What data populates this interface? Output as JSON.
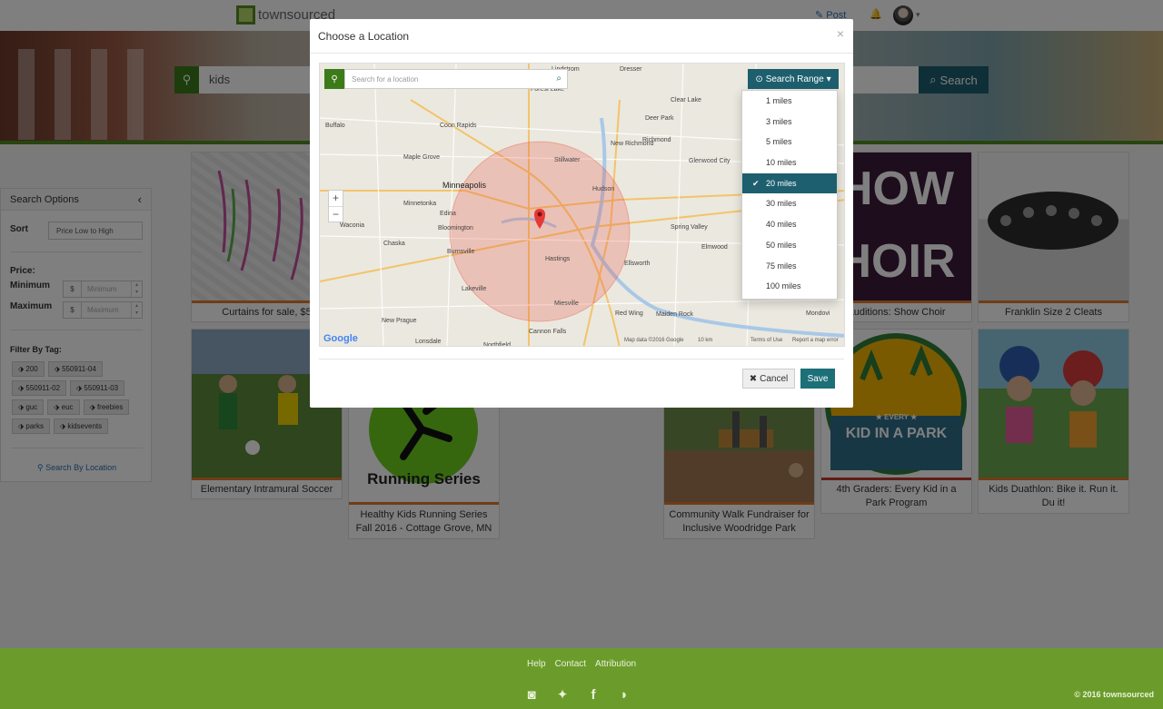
{
  "nav": {
    "brand": "townsourced",
    "post_label": "Post",
    "post_icon": "pencil-square-icon",
    "bell_icon": "bell-icon"
  },
  "hero": {
    "search_value": "kids",
    "search_button": "Search"
  },
  "sidebar": {
    "title": "Search Options",
    "sort_label": "Sort",
    "sort_value": "Price Low to High",
    "price_label": "Price:",
    "minimum_label": "Minimum",
    "maximum_label": "Maximum",
    "min_placeholder": "Minimum",
    "max_placeholder": "Maximum",
    "currency": "$",
    "tags_label": "Filter By Tag:",
    "tags": [
      "200",
      "550911-04",
      "550911-02",
      "550911-03",
      "guc",
      "euc",
      "freebies",
      "parks",
      "kidsevents"
    ],
    "location_link": "Search By Location"
  },
  "cards": [
    {
      "caption": "Curtains for sale, $5"
    },
    {
      "caption": "Auditions: Show Choir"
    },
    {
      "caption": "Franklin Size 2 Cleats"
    },
    {
      "caption": "Elementary Intramural Soccer"
    },
    {
      "caption": "Healthy Kids Running Series Fall 2016 - Cottage Grove, MN",
      "image_text": "Running Series"
    },
    {
      "caption": "Community Walk Fundraiser for Inclusive Woodridge Park"
    },
    {
      "caption": "4th Graders: Every Kid in a Park Program",
      "image_text_top": "★ EVERY ★",
      "image_text_bottom": "KID IN A PARK"
    },
    {
      "caption": "Kids Duathlon: Bike it. Run it. Du it!"
    }
  ],
  "footer": {
    "links": [
      "Help",
      "Contact",
      "Attribution"
    ],
    "icons": [
      "instagram-icon",
      "twitter-icon",
      "facebook-icon",
      "rss-icon"
    ],
    "copyright": "© 2016 townsourced"
  },
  "modal": {
    "title": "Choose a Location",
    "close": "×",
    "search_placeholder": "Search for a location",
    "range_button": "Search Range",
    "range_options": [
      "1 miles",
      "3 miles",
      "5 miles",
      "10 miles",
      "20 miles",
      "30 miles",
      "40 miles",
      "50 miles",
      "75 miles",
      "100 miles"
    ],
    "range_selected": "20 miles",
    "cancel": "Cancel",
    "save": "Save",
    "map": {
      "zoom_in": "+",
      "zoom_out": "−",
      "google": "Google",
      "map_data": "Map data ©2016 Google",
      "scale": "10 km",
      "terms": "Terms of Use",
      "report": "Report a map error",
      "places": [
        "Forest Lake",
        "Coon Rapids",
        "Buffalo",
        "Maple Grove",
        "Minneapolis",
        "Minnetonka",
        "Edina",
        "Bloomington",
        "Burnsville",
        "Chaska",
        "Waconia",
        "Lakeville",
        "Hastings",
        "Stillwater",
        "Dresser",
        "Deer Park",
        "Clear Lake",
        "New Richmond",
        "Hudson",
        "Glenwood City",
        "Spring Valley",
        "Elmwood",
        "Ellsworth",
        "Red Wing",
        "Miesville",
        "Cannon Falls",
        "Lonsdale",
        "New Prague",
        "Northfield",
        "Maiden Rock",
        "Mondovi",
        "Richmond",
        "Lindstrom"
      ]
    }
  }
}
